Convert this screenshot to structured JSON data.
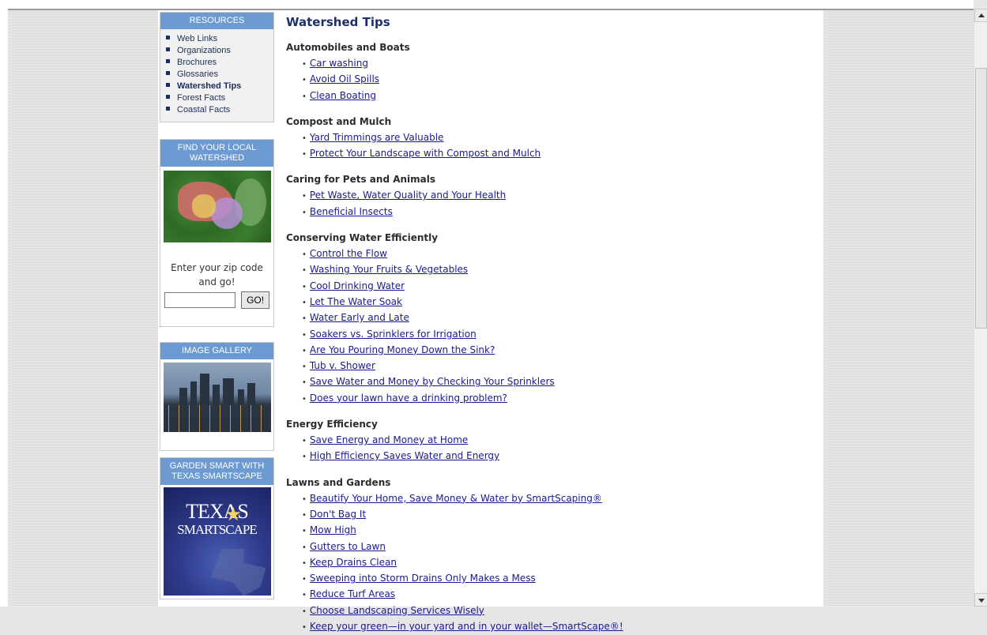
{
  "sidebar": {
    "resources": {
      "title": "RESOURCES",
      "items": [
        {
          "label": "Web Links",
          "active": false
        },
        {
          "label": "Organizations",
          "active": false
        },
        {
          "label": "Brochures",
          "active": false
        },
        {
          "label": "Glossaries",
          "active": false
        },
        {
          "label": "Watershed Tips",
          "active": true
        },
        {
          "label": "Forest Facts",
          "active": false
        },
        {
          "label": "Coastal Facts",
          "active": false
        }
      ]
    },
    "watershed": {
      "title": "FIND YOUR LOCAL WATERSHED",
      "zip_prompt": "Enter your zip code and go!",
      "zip_value": "",
      "go_label": "GO!"
    },
    "gallery": {
      "title": "IMAGE GALLERY"
    },
    "smartscape": {
      "title": "GARDEN SMART WITH TEXAS SMARTSCAPE",
      "logo_line1": "TEXAS",
      "logo_line2": "SMARTSCAPE"
    }
  },
  "main": {
    "title": "Watershed Tips",
    "sections": [
      {
        "heading": "Automobiles and Boats",
        "links": [
          "Car washing",
          "Avoid Oil Spills",
          "Clean Boating"
        ]
      },
      {
        "heading": "Compost and Mulch",
        "links": [
          "Yard Trimmings are Valuable",
          "Protect Your Landscape with Compost and Mulch"
        ]
      },
      {
        "heading": "Caring for Pets and Animals",
        "links": [
          "Pet Waste, Water Quality and Your Health",
          "Beneficial Insects"
        ]
      },
      {
        "heading": "Conserving Water Efficiently",
        "links": [
          "Control the Flow",
          "Washing Your Fruits & Vegetables",
          "Cool Drinking Water",
          "Let The Water Soak",
          "Water Early and Late",
          "Soakers vs. Sprinklers for Irrigation",
          "Are You Pouring Money Down the Sink?",
          "Tub v. Shower",
          "Save Water and Money by Checking Your Sprinklers",
          "Does your lawn have a drinking problem?"
        ]
      },
      {
        "heading": "Energy Efficiency",
        "links": [
          "Save Energy and Money at Home",
          "High Efficiency Saves Water and Energy"
        ]
      },
      {
        "heading": "Lawns and Gardens",
        "links": [
          "Beautify Your Home, Save Money & Water by SmartScaping®",
          "Don't Bag It",
          "Mow High",
          "Gutters to Lawn",
          "Keep Drains Clean",
          "Sweeping into Storm Drains Only Makes a Mess",
          "Reduce Turf Areas",
          "Choose Landscaping Services Wisely",
          "Keep your green—in your yard and in your wallet—SmartScape®!"
        ]
      }
    ]
  },
  "colors": {
    "box_header": "#6d9bd1",
    "link": "#1a1a8c",
    "title": "#1c2f6b"
  }
}
